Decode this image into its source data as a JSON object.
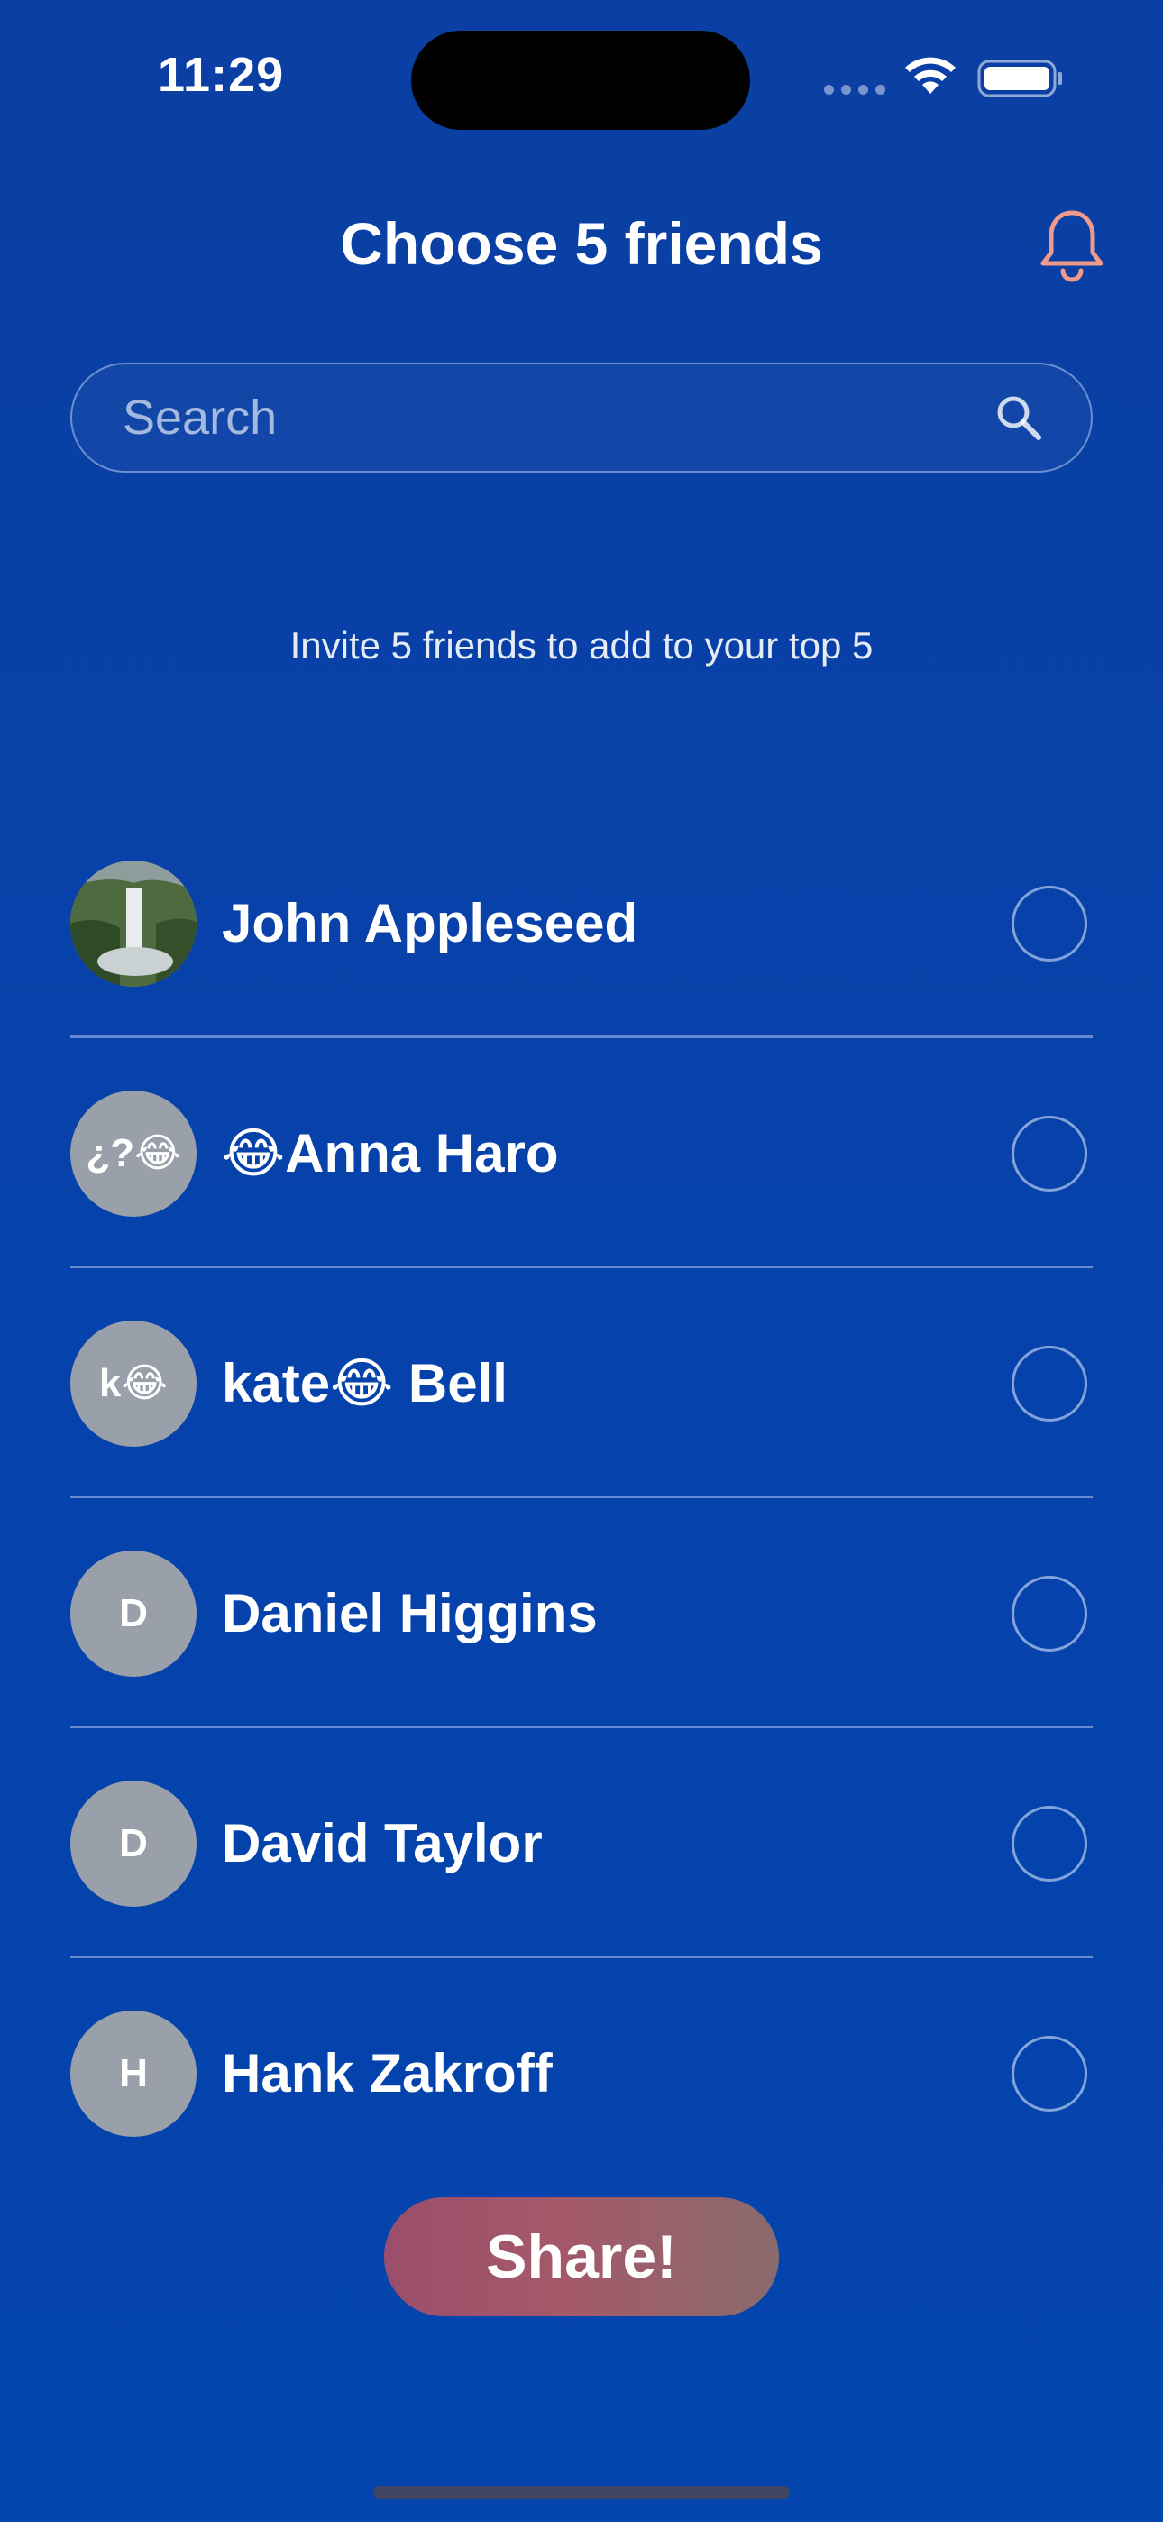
{
  "status_bar": {
    "time": "11:29"
  },
  "header": {
    "title": "Choose 5 friends",
    "bell_icon": "bell-icon",
    "bell_color": "#f09a8a"
  },
  "search": {
    "placeholder": "Search",
    "value": ""
  },
  "invite_text": "Invite 5 friends to add to your top 5",
  "friends": [
    {
      "avatar_initials": "",
      "avatar_type": "photo-waterfall",
      "name": "John Appleseed",
      "selected": false
    },
    {
      "avatar_initials": "¿?😂",
      "avatar_type": "initials",
      "name": "😂Anna Haro",
      "selected": false
    },
    {
      "avatar_initials": "k😂",
      "avatar_type": "initials",
      "name": "kate😂 Bell",
      "selected": false
    },
    {
      "avatar_initials": "D",
      "avatar_type": "initials",
      "name": "Daniel Higgins",
      "selected": false
    },
    {
      "avatar_initials": "D",
      "avatar_type": "initials",
      "name": "David Taylor",
      "selected": false
    },
    {
      "avatar_initials": "H",
      "avatar_type": "initials",
      "name": "Hank Zakroff",
      "selected": false
    }
  ],
  "share_button": {
    "label": "Share!"
  },
  "colors": {
    "background": "#0642ab",
    "share_button": "#9a4e6b",
    "avatar_placeholder": "#9aa0aa"
  }
}
